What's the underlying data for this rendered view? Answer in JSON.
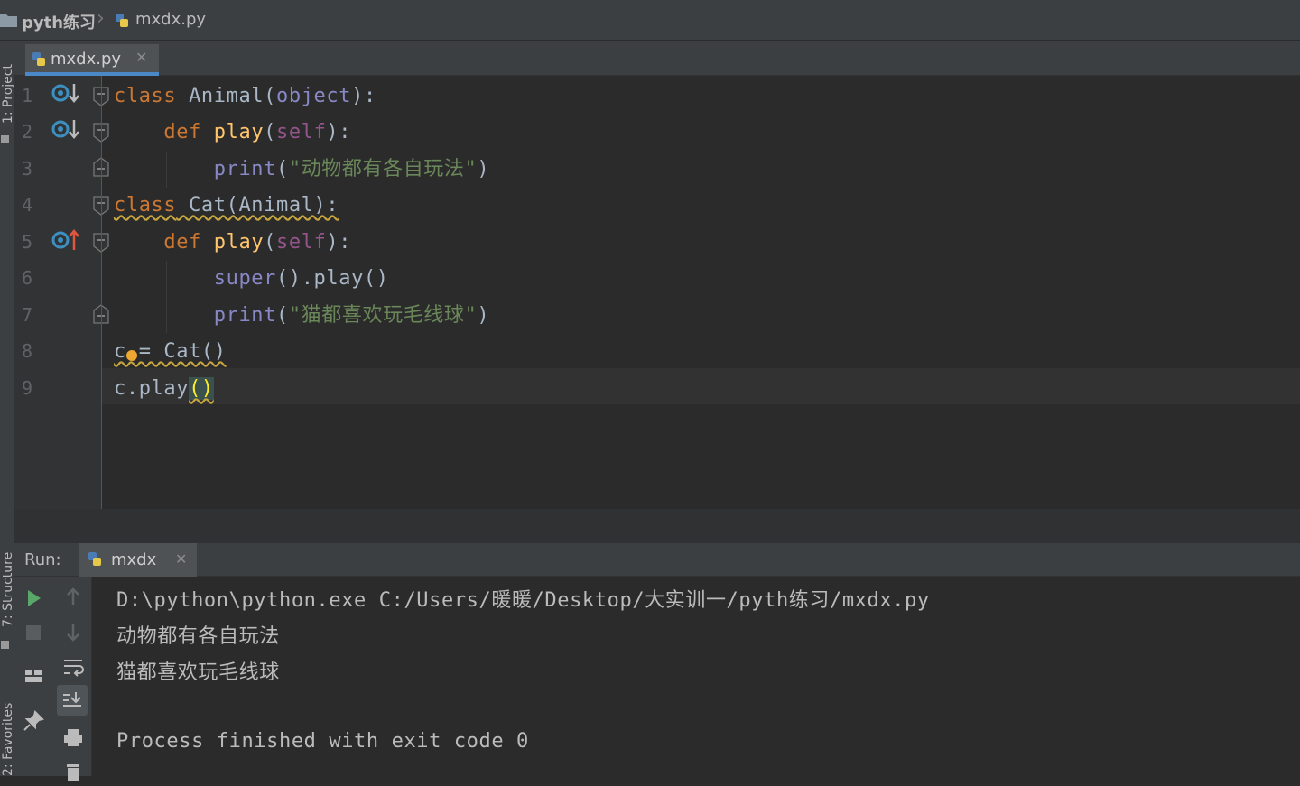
{
  "breadcrumb": {
    "project": "pyth练习",
    "file": "mxdx.py"
  },
  "left_strip": {
    "project_tab": "1: Project",
    "structure_tab": "7: Structure",
    "favorites_tab": "2: Favorites"
  },
  "editor": {
    "active_tab": "mxdx.py",
    "line_numbers": [
      "1",
      "2",
      "3",
      "4",
      "5",
      "6",
      "7",
      "8",
      "9"
    ],
    "lines": {
      "l1": {
        "kw": "class",
        "name": " Animal",
        "p1": "(",
        "base": "object",
        "p2": "):"
      },
      "l2": {
        "indent": "    ",
        "kw": "def",
        "name": " play",
        "p1": "(",
        "self": "self",
        "p2": "):"
      },
      "l3": {
        "indent": "        ",
        "call": "print",
        "p1": "(",
        "str": "\"动物都有各自玩法\"",
        "p2": ")"
      },
      "l4": {
        "kw": "class",
        "rest": " Cat(Animal):"
      },
      "l5": {
        "indent": "    ",
        "kw": "def",
        "name": " play",
        "p1": "(",
        "self": "self",
        "p2": "):"
      },
      "l6": {
        "indent": "        ",
        "call": "super",
        "rest": "().play()"
      },
      "l7": {
        "indent": "        ",
        "call": "print",
        "p1": "(",
        "str": "\"猫都喜欢玩毛线球\"",
        "p2": ")"
      },
      "l8": {
        "text": "c = Cat()"
      },
      "l9": {
        "text": "c.play",
        "paren": "()"
      }
    },
    "gutter_icons": [
      "override-down-icon",
      "override-down-icon",
      "overriding-up-icon"
    ]
  },
  "run": {
    "title": "Run:",
    "tab": "mxdx",
    "console": [
      "D:\\python\\python.exe C:/Users/暖暖/Desktop/大实训一/pyth练习/mxdx.py",
      "动物都有各自玩法",
      "猫都喜欢玩毛线球",
      "",
      "Process finished with exit code 0"
    ]
  },
  "colors": {
    "background": "#2b2b2b",
    "keyword": "#cc7832",
    "function": "#ffc66d",
    "string": "#6a8759",
    "self": "#94558d",
    "builtin": "#8888c6",
    "accent": "#4a88c7"
  }
}
